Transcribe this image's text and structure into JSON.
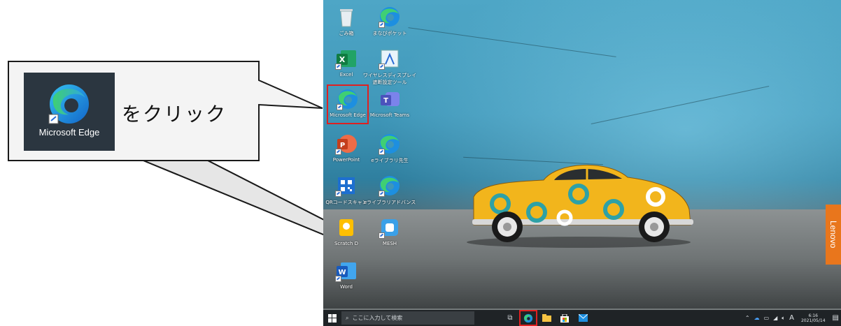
{
  "callout": {
    "icon_label": "Microsoft Edge",
    "instruction": "をクリック"
  },
  "desktop": {
    "icons": [
      {
        "id": "recycle",
        "label": "ごみ箱",
        "icon": "recycle-bin-icon"
      },
      {
        "id": "manabi",
        "label": "まなびポケット",
        "icon": "edge-shortcut-icon"
      },
      {
        "id": "excel",
        "label": "Excel",
        "icon": "excel-icon"
      },
      {
        "id": "wireless",
        "label": "ワイヤレスディスプレイ\n遮断設定ツール",
        "icon": "wireless-display-icon"
      },
      {
        "id": "edge",
        "label": "Microsoft Edge",
        "icon": "edge-icon"
      },
      {
        "id": "teams",
        "label": "Microsoft Teams",
        "icon": "teams-icon"
      },
      {
        "id": "ppt",
        "label": "PowerPoint",
        "icon": "powerpoint-icon"
      },
      {
        "id": "elib1",
        "label": "eライブラリ先生",
        "icon": "edge-shortcut-icon"
      },
      {
        "id": "qr",
        "label": "QRコードスキャン",
        "icon": "qr-icon"
      },
      {
        "id": "elib2",
        "label": "eライブラリアドバンス",
        "icon": "edge-shortcut-icon"
      },
      {
        "id": "scratch",
        "label": "Scratch D",
        "icon": "scratch-icon"
      },
      {
        "id": "mesh",
        "label": "MESH",
        "icon": "mesh-icon"
      },
      {
        "id": "word",
        "label": "Word",
        "icon": "word-icon"
      }
    ],
    "brand_tab": "Lenovo"
  },
  "taskbar": {
    "search_placeholder": "ここに入力して検索",
    "ime": "A",
    "time": "6:16",
    "date": "2021/05/14"
  },
  "colors": {
    "highlight": "#e02020",
    "taskbar": "#1f2326",
    "car": "#f2b51c"
  }
}
